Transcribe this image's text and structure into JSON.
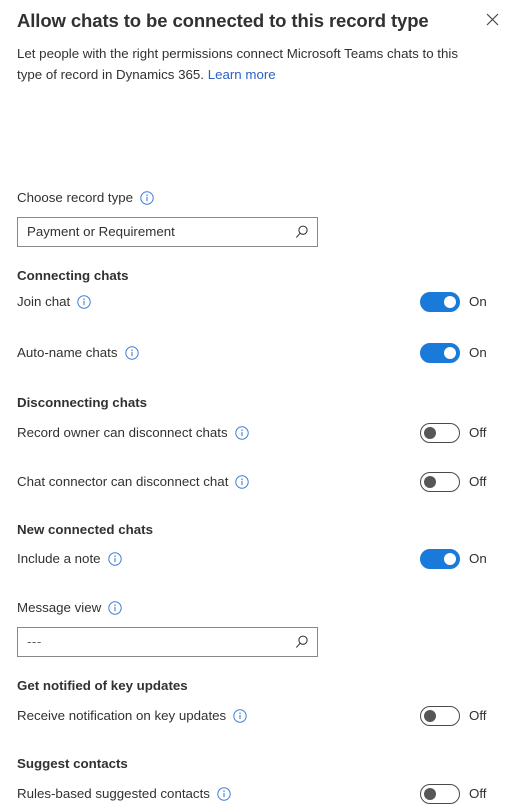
{
  "header": {
    "title": "Allow chats to be connected to this record type",
    "subtitle_text": "Let people with the right permissions connect Microsoft Teams chats to this type of record in Dynamics 365. ",
    "learn_more_label": "Learn more",
    "close_icon": "close-icon"
  },
  "record_type": {
    "label": "Choose record type",
    "info_icon": "info-icon",
    "value": "Payment or Requirement",
    "search_icon": "search-icon"
  },
  "message_view": {
    "label": "Message view",
    "info_icon": "info-icon",
    "value": "---",
    "search_icon": "search-icon"
  },
  "groups": [
    {
      "heading": "Connecting chats",
      "settings": [
        {
          "label": "Join chat",
          "state": "On",
          "on": true
        },
        {
          "label": "Auto-name chats",
          "state": "On",
          "on": true
        }
      ]
    },
    {
      "heading": "Disconnecting chats",
      "settings": [
        {
          "label": "Record owner can disconnect chats",
          "state": "Off",
          "on": false
        },
        {
          "label": "Chat connector can disconnect chat",
          "state": "Off",
          "on": false
        }
      ]
    },
    {
      "heading": "New connected chats",
      "settings": [
        {
          "label": "Include a note",
          "state": "On",
          "on": true
        }
      ]
    },
    {
      "heading": "Get notified of key updates",
      "settings": [
        {
          "label": "Receive notification on key updates",
          "state": "Off",
          "on": false
        }
      ]
    },
    {
      "heading": "Suggest contacts",
      "settings": [
        {
          "label": "Rules-based suggested contacts",
          "state": "Off",
          "on": false
        }
      ]
    }
  ],
  "colors": {
    "accent": "#1a7ad9",
    "link": "#2a62c6",
    "text": "#323130",
    "border": "#8a8886",
    "toggle_off_knob": "#585654"
  }
}
